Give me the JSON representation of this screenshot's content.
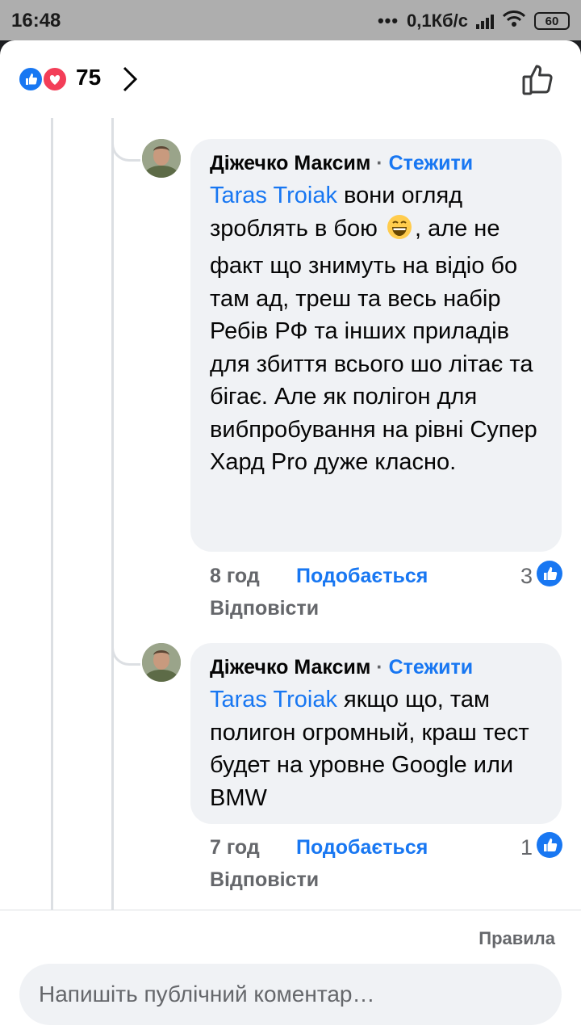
{
  "status_bar": {
    "time": "16:48",
    "dots": "•••",
    "network_speed": "0,1Кб/с",
    "battery": "60",
    "icons": [
      "signal-icon",
      "wifi-icon",
      "battery-icon"
    ]
  },
  "reactions": {
    "count": "75",
    "types": [
      "like-reaction-icon",
      "love-reaction-icon"
    ],
    "colors": {
      "like": "#1877f2",
      "love": "#f33e58"
    }
  },
  "comments": [
    {
      "author": "Діжечко Максим",
      "separator": "·",
      "follow": "Стежити",
      "mention": "Taras Troiak",
      "text_before_emoji": " вони огляд зроблять в бою ",
      "emoji": "grinning-face-emoji",
      "text_after_emoji": ", але не факт що знимуть на відіо бо там ад, треш та весь набір Ребів РФ та інших приладів для збиття всього шо літає та бігає. Але як полігон для вибпробування на рівні Супер Хард Pro дуже класно.",
      "time": "8 год",
      "like_label": "Подобається",
      "reply_label": "Відповісти",
      "reaction_count": "3"
    },
    {
      "author": "Діжечко Максим",
      "separator": "·",
      "follow": "Стежити",
      "mention": "Taras Troiak",
      "text": " якщо що, там полигон огромный, краш тест будет на уровне Google или BMW",
      "time": "7 год",
      "like_label": "Подобається",
      "reply_label": "Відповісти",
      "reaction_count": "1"
    }
  ],
  "footer": {
    "rules_label": "Правила",
    "composer_placeholder": "Напишіть публічний коментар…"
  },
  "colors": {
    "accent": "#1877f2",
    "bubble": "#f0f2f5",
    "muted_text": "#65676b",
    "status_bar": "#aeaeae"
  }
}
